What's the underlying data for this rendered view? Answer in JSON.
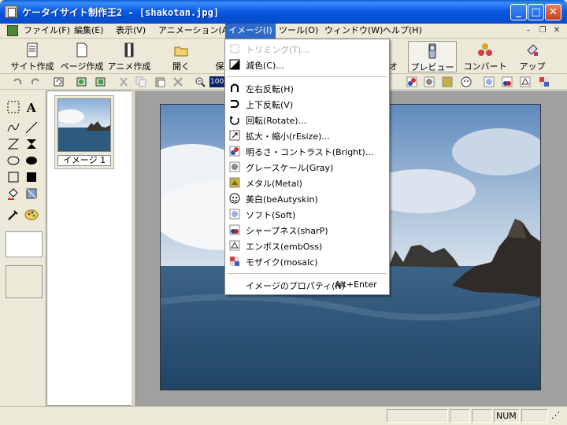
{
  "window": {
    "title": "ケータイサイト制作王2 - [shakotan.jpg]"
  },
  "titlebar_buttons": {
    "minimize": "_",
    "maximize": "□",
    "close": "✕"
  },
  "menubar": {
    "items": [
      {
        "label": "ファイル(F)"
      },
      {
        "label": "編集(E)"
      },
      {
        "label": "表示(V)"
      },
      {
        "label": "アニメーション(A)"
      },
      {
        "label": "イメージ(I)"
      },
      {
        "label": "ツール(O)"
      },
      {
        "label": "ウィンドウ(W)"
      },
      {
        "label": "ヘルプ(H)"
      }
    ],
    "active_index": 4,
    "mdi_controls": {
      "minimize": "–",
      "restore": "❐",
      "close": "✕"
    }
  },
  "big_toolbar": {
    "buttons": [
      {
        "label": "サイト作成",
        "icon": "site-create-icon"
      },
      {
        "label": "ページ作成",
        "icon": "page-create-icon"
      },
      {
        "label": "アニメ作成",
        "icon": "anime-create-icon"
      },
      {
        "label": "開く",
        "icon": "open-folder-icon"
      },
      {
        "label": "保",
        "icon": "save-icon"
      },
      {
        "label": "プレビュー",
        "icon": "preview-phone-icon"
      },
      {
        "label": "コンバート",
        "icon": "convert-icon"
      },
      {
        "label": "アップ",
        "icon": "upload-icon"
      }
    ]
  },
  "small_toolbar": {
    "zoom_text": "100"
  },
  "thumbnails": [
    {
      "label": "イメージ 1"
    }
  ],
  "image_menu": {
    "items": [
      {
        "label": "トリミング(T)...",
        "icon": "crop-icon",
        "disabled": true
      },
      {
        "label": "減色(C)...",
        "icon": "reduce-color-icon",
        "disabled": false
      },
      {
        "label": "左右反転(H)",
        "icon": "flip-horizontal-icon",
        "disabled": false
      },
      {
        "label": "上下反転(V)",
        "icon": "flip-vertical-icon",
        "disabled": false
      },
      {
        "label": "回転(Rotate)...",
        "icon": "rotate-icon",
        "disabled": false
      },
      {
        "label": "拡大・縮小(rEsize)...",
        "icon": "resize-icon",
        "disabled": false
      },
      {
        "label": "明るさ・コントラスト(Bright)...",
        "icon": "brightness-icon",
        "disabled": false
      },
      {
        "label": "グレースケール(Gray)",
        "icon": "grayscale-icon",
        "disabled": false
      },
      {
        "label": "メタル(Metal)",
        "icon": "metal-icon",
        "disabled": false
      },
      {
        "label": "美白(beAutyskin)",
        "icon": "beauty-skin-icon",
        "disabled": false
      },
      {
        "label": "ソフト(Soft)",
        "icon": "soft-icon",
        "disabled": false
      },
      {
        "label": "シャープネス(sharP)",
        "icon": "sharpness-icon",
        "disabled": false
      },
      {
        "label": "エンボス(embOss)",
        "icon": "emboss-icon",
        "disabled": false
      },
      {
        "label": "モザイク(mosaIc)",
        "icon": "mosaic-icon",
        "disabled": false
      },
      {
        "label": "イメージのプロパティ(N)",
        "shortcut": "Alt+Enter",
        "disabled": false
      }
    ]
  },
  "statusbar": {
    "num": "NUM"
  },
  "colors": {
    "titlebar": "#0550d6",
    "menu_highlight": "#316ac5",
    "canvas_bg": "#a0a0a0"
  }
}
